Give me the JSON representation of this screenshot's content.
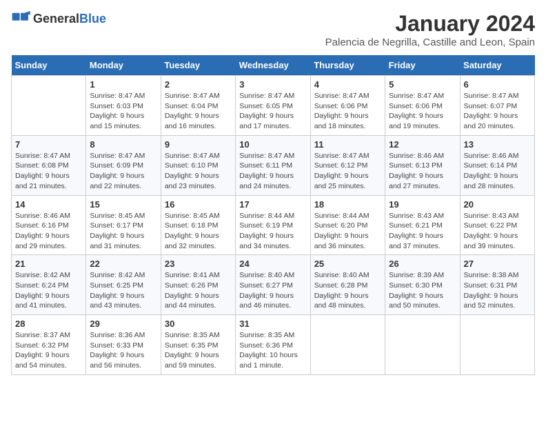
{
  "header": {
    "logo_general": "General",
    "logo_blue": "Blue",
    "title": "January 2024",
    "subtitle": "Palencia de Negrilla, Castille and Leon, Spain"
  },
  "calendar": {
    "days_of_week": [
      "Sunday",
      "Monday",
      "Tuesday",
      "Wednesday",
      "Thursday",
      "Friday",
      "Saturday"
    ],
    "weeks": [
      [
        {
          "day": "",
          "sunrise": "",
          "sunset": "",
          "daylight": ""
        },
        {
          "day": "1",
          "sunrise": "Sunrise: 8:47 AM",
          "sunset": "Sunset: 6:03 PM",
          "daylight": "Daylight: 9 hours and 15 minutes."
        },
        {
          "day": "2",
          "sunrise": "Sunrise: 8:47 AM",
          "sunset": "Sunset: 6:04 PM",
          "daylight": "Daylight: 9 hours and 16 minutes."
        },
        {
          "day": "3",
          "sunrise": "Sunrise: 8:47 AM",
          "sunset": "Sunset: 6:05 PM",
          "daylight": "Daylight: 9 hours and 17 minutes."
        },
        {
          "day": "4",
          "sunrise": "Sunrise: 8:47 AM",
          "sunset": "Sunset: 6:06 PM",
          "daylight": "Daylight: 9 hours and 18 minutes."
        },
        {
          "day": "5",
          "sunrise": "Sunrise: 8:47 AM",
          "sunset": "Sunset: 6:06 PM",
          "daylight": "Daylight: 9 hours and 19 minutes."
        },
        {
          "day": "6",
          "sunrise": "Sunrise: 8:47 AM",
          "sunset": "Sunset: 6:07 PM",
          "daylight": "Daylight: 9 hours and 20 minutes."
        }
      ],
      [
        {
          "day": "7",
          "sunrise": "Sunrise: 8:47 AM",
          "sunset": "Sunset: 6:08 PM",
          "daylight": "Daylight: 9 hours and 21 minutes."
        },
        {
          "day": "8",
          "sunrise": "Sunrise: 8:47 AM",
          "sunset": "Sunset: 6:09 PM",
          "daylight": "Daylight: 9 hours and 22 minutes."
        },
        {
          "day": "9",
          "sunrise": "Sunrise: 8:47 AM",
          "sunset": "Sunset: 6:10 PM",
          "daylight": "Daylight: 9 hours and 23 minutes."
        },
        {
          "day": "10",
          "sunrise": "Sunrise: 8:47 AM",
          "sunset": "Sunset: 6:11 PM",
          "daylight": "Daylight: 9 hours and 24 minutes."
        },
        {
          "day": "11",
          "sunrise": "Sunrise: 8:47 AM",
          "sunset": "Sunset: 6:12 PM",
          "daylight": "Daylight: 9 hours and 25 minutes."
        },
        {
          "day": "12",
          "sunrise": "Sunrise: 8:46 AM",
          "sunset": "Sunset: 6:13 PM",
          "daylight": "Daylight: 9 hours and 27 minutes."
        },
        {
          "day": "13",
          "sunrise": "Sunrise: 8:46 AM",
          "sunset": "Sunset: 6:14 PM",
          "daylight": "Daylight: 9 hours and 28 minutes."
        }
      ],
      [
        {
          "day": "14",
          "sunrise": "Sunrise: 8:46 AM",
          "sunset": "Sunset: 6:16 PM",
          "daylight": "Daylight: 9 hours and 29 minutes."
        },
        {
          "day": "15",
          "sunrise": "Sunrise: 8:45 AM",
          "sunset": "Sunset: 6:17 PM",
          "daylight": "Daylight: 9 hours and 31 minutes."
        },
        {
          "day": "16",
          "sunrise": "Sunrise: 8:45 AM",
          "sunset": "Sunset: 6:18 PM",
          "daylight": "Daylight: 9 hours and 32 minutes."
        },
        {
          "day": "17",
          "sunrise": "Sunrise: 8:44 AM",
          "sunset": "Sunset: 6:19 PM",
          "daylight": "Daylight: 9 hours and 34 minutes."
        },
        {
          "day": "18",
          "sunrise": "Sunrise: 8:44 AM",
          "sunset": "Sunset: 6:20 PM",
          "daylight": "Daylight: 9 hours and 36 minutes."
        },
        {
          "day": "19",
          "sunrise": "Sunrise: 8:43 AM",
          "sunset": "Sunset: 6:21 PM",
          "daylight": "Daylight: 9 hours and 37 minutes."
        },
        {
          "day": "20",
          "sunrise": "Sunrise: 8:43 AM",
          "sunset": "Sunset: 6:22 PM",
          "daylight": "Daylight: 9 hours and 39 minutes."
        }
      ],
      [
        {
          "day": "21",
          "sunrise": "Sunrise: 8:42 AM",
          "sunset": "Sunset: 6:24 PM",
          "daylight": "Daylight: 9 hours and 41 minutes."
        },
        {
          "day": "22",
          "sunrise": "Sunrise: 8:42 AM",
          "sunset": "Sunset: 6:25 PM",
          "daylight": "Daylight: 9 hours and 43 minutes."
        },
        {
          "day": "23",
          "sunrise": "Sunrise: 8:41 AM",
          "sunset": "Sunset: 6:26 PM",
          "daylight": "Daylight: 9 hours and 44 minutes."
        },
        {
          "day": "24",
          "sunrise": "Sunrise: 8:40 AM",
          "sunset": "Sunset: 6:27 PM",
          "daylight": "Daylight: 9 hours and 46 minutes."
        },
        {
          "day": "25",
          "sunrise": "Sunrise: 8:40 AM",
          "sunset": "Sunset: 6:28 PM",
          "daylight": "Daylight: 9 hours and 48 minutes."
        },
        {
          "day": "26",
          "sunrise": "Sunrise: 8:39 AM",
          "sunset": "Sunset: 6:30 PM",
          "daylight": "Daylight: 9 hours and 50 minutes."
        },
        {
          "day": "27",
          "sunrise": "Sunrise: 8:38 AM",
          "sunset": "Sunset: 6:31 PM",
          "daylight": "Daylight: 9 hours and 52 minutes."
        }
      ],
      [
        {
          "day": "28",
          "sunrise": "Sunrise: 8:37 AM",
          "sunset": "Sunset: 6:32 PM",
          "daylight": "Daylight: 9 hours and 54 minutes."
        },
        {
          "day": "29",
          "sunrise": "Sunrise: 8:36 AM",
          "sunset": "Sunset: 6:33 PM",
          "daylight": "Daylight: 9 hours and 56 minutes."
        },
        {
          "day": "30",
          "sunrise": "Sunrise: 8:35 AM",
          "sunset": "Sunset: 6:35 PM",
          "daylight": "Daylight: 9 hours and 59 minutes."
        },
        {
          "day": "31",
          "sunrise": "Sunrise: 8:35 AM",
          "sunset": "Sunset: 6:36 PM",
          "daylight": "Daylight: 10 hours and 1 minute."
        },
        {
          "day": "",
          "sunrise": "",
          "sunset": "",
          "daylight": ""
        },
        {
          "day": "",
          "sunrise": "",
          "sunset": "",
          "daylight": ""
        },
        {
          "day": "",
          "sunrise": "",
          "sunset": "",
          "daylight": ""
        }
      ]
    ]
  }
}
